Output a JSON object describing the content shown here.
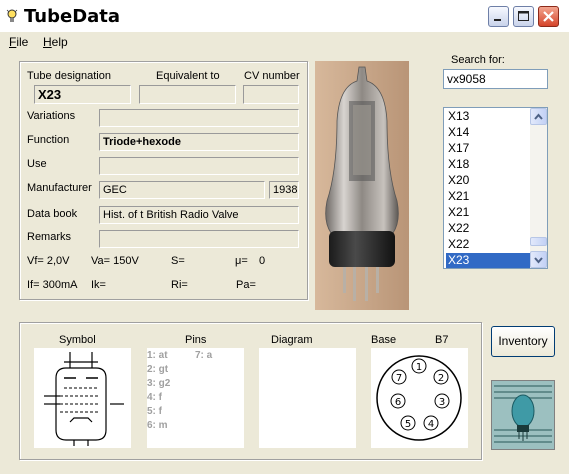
{
  "window": {
    "title": "TubeData"
  },
  "menu": {
    "file": "File",
    "help": "Help"
  },
  "labels": {
    "tube_designation": "Tube designation",
    "equivalent_to": "Equivalent to",
    "cv_number": "CV number",
    "variations": "Variations",
    "function": "Function",
    "use": "Use",
    "manufacturer": "Manufacturer",
    "data_book": "Data book",
    "remarks": "Remarks",
    "vf": "Vf= 2,0V",
    "va": "Va= 150V",
    "s": "S=",
    "mu": "μ=",
    "mu_value": "0",
    "if": "If= 300mA",
    "ik": "Ik=",
    "ri": "Ri=",
    "pa": "Pa="
  },
  "values": {
    "tube_designation": "X23",
    "equivalent_to": "",
    "cv_number": "",
    "variations": "",
    "function": "Triode+hexode",
    "use": "",
    "manufacturer": "GEC",
    "year": "1938",
    "data_book": "Hist. of t British Radio Valve",
    "remarks": ""
  },
  "search": {
    "label": "Search for:",
    "value": "vx9058"
  },
  "tube_list": {
    "items": [
      "X13",
      "X14",
      "X17",
      "X18",
      "X20",
      "X21",
      "X21",
      "X22",
      "X22",
      "X23"
    ],
    "selected": "X23"
  },
  "bottom": {
    "symbol_label": "Symbol",
    "pins_label": "Pins",
    "diagram_label": "Diagram",
    "base_label": "Base",
    "base_type": "B7",
    "pins_left": [
      "1: at",
      "2: gt",
      "3: g2",
      "4: f",
      "5: f",
      "6: m"
    ],
    "pins_right": [
      "7: a"
    ],
    "base_pin_numbers": [
      "1",
      "2",
      "3",
      "4",
      "5",
      "6",
      "7"
    ]
  },
  "buttons": {
    "inventory": "Inventory"
  },
  "colors": {
    "selection": "#316ac5",
    "window_bg": "#ece9d8",
    "close_button": "#d5442a"
  }
}
